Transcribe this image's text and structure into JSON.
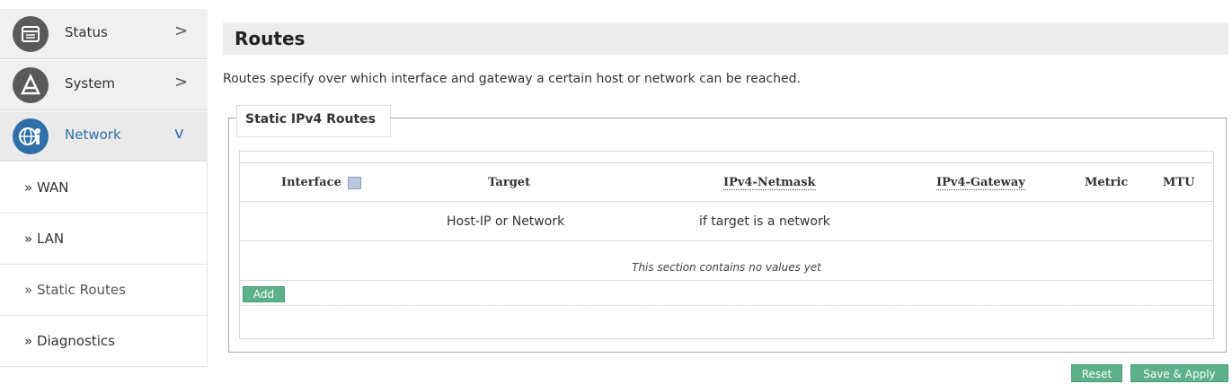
{
  "sidebar": {
    "menu": [
      {
        "label": "Status",
        "chevron": ">"
      },
      {
        "label": "System",
        "chevron": ">"
      },
      {
        "label": "Network",
        "chevron": "v"
      }
    ],
    "submenu": [
      {
        "label": "» WAN"
      },
      {
        "label": "» LAN"
      },
      {
        "label": "» Static Routes"
      },
      {
        "label": "» Diagnostics"
      }
    ]
  },
  "page": {
    "title": "Routes",
    "description": "Routes specify over which interface and gateway a certain host or network can be reached."
  },
  "section": {
    "legend": "Static IPv4 Routes",
    "columns": {
      "interface": "Interface",
      "target": "Target",
      "netmask": "IPv4-Netmask",
      "gateway": "IPv4-Gateway",
      "metric": "Metric",
      "mtu": "MTU"
    },
    "hints": {
      "target": "Host-IP or Network",
      "netmask": "if target is a network"
    },
    "empty_text": "This section contains no values yet",
    "add_label": "Add"
  },
  "footer": {
    "reset_label": "Reset",
    "save_label": "Save & Apply"
  },
  "colors": {
    "button_green": "#5cb08a",
    "accent_blue": "#2f6fa8"
  }
}
